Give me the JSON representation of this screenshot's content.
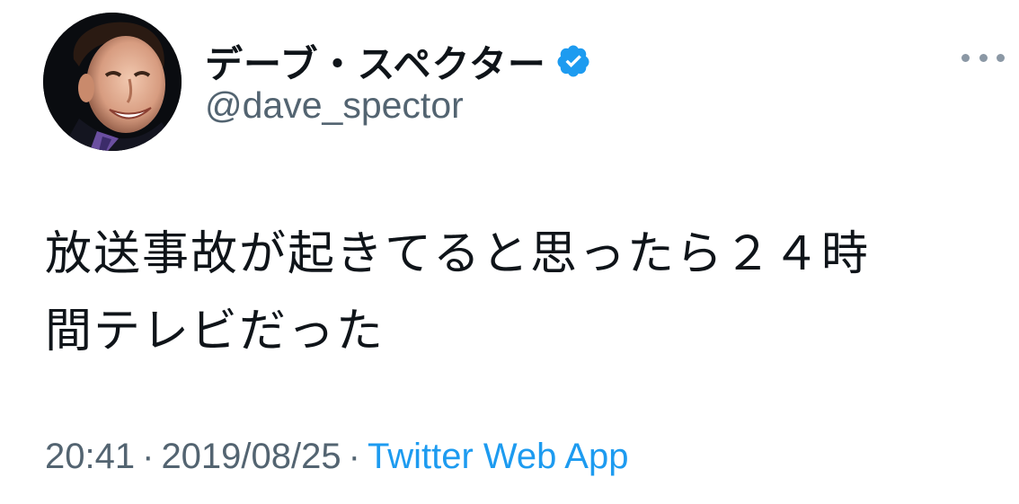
{
  "tweet": {
    "author": {
      "display_name": "デーブ・スペクター",
      "handle": "@dave_spector",
      "verified": true,
      "avatar_icon": "user-avatar-photo"
    },
    "more_menu_icon": "more-horizontal-icon",
    "text_line_1": "放送事故が起きてると思ったら２４時",
    "text_line_2": "間テレビだった",
    "time": "20:41",
    "separator": "·",
    "date": "2019/08/25",
    "source": "Twitter Web App"
  },
  "colors": {
    "text_primary": "#0f1419",
    "text_secondary": "#536471",
    "link": "#1d9bf0",
    "verified_badge": "#1d9bf0",
    "menu_dots": "#8b98a5"
  }
}
